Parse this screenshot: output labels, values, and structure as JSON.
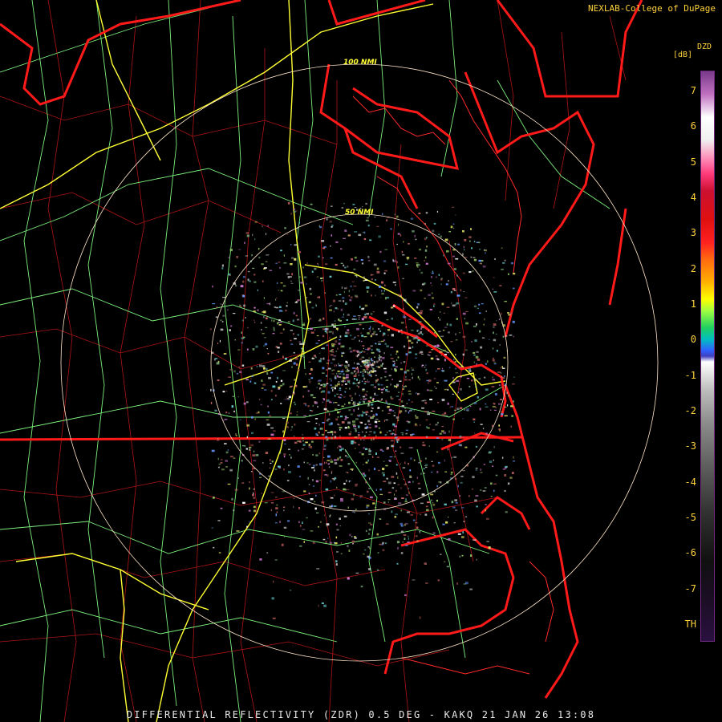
{
  "credit": "NEXLAB-College of DuPage",
  "rings": {
    "inner_label": "50 NMI",
    "outer_label": "100 NMI"
  },
  "footer": "DIFFERENTIAL REFLECTIVITY (ZDR) 0.5 DEG - KAKQ 21 JAN 26 13:08",
  "scale": {
    "name": "DZD",
    "unit": "[dB]",
    "ticks": [
      "7",
      "6",
      "5",
      "4",
      "3",
      "2",
      "1",
      "0",
      "-1",
      "-2",
      "-3",
      "-4",
      "-5",
      "-6",
      "-7",
      "TH"
    ]
  },
  "colors": {
    "state_border": "#ff1a1a",
    "county_border": "#b01515",
    "interstate": "#ffff33",
    "highway": "#7cf07c",
    "range_ring": "#ffe6c8",
    "text": "#ffd23a"
  }
}
